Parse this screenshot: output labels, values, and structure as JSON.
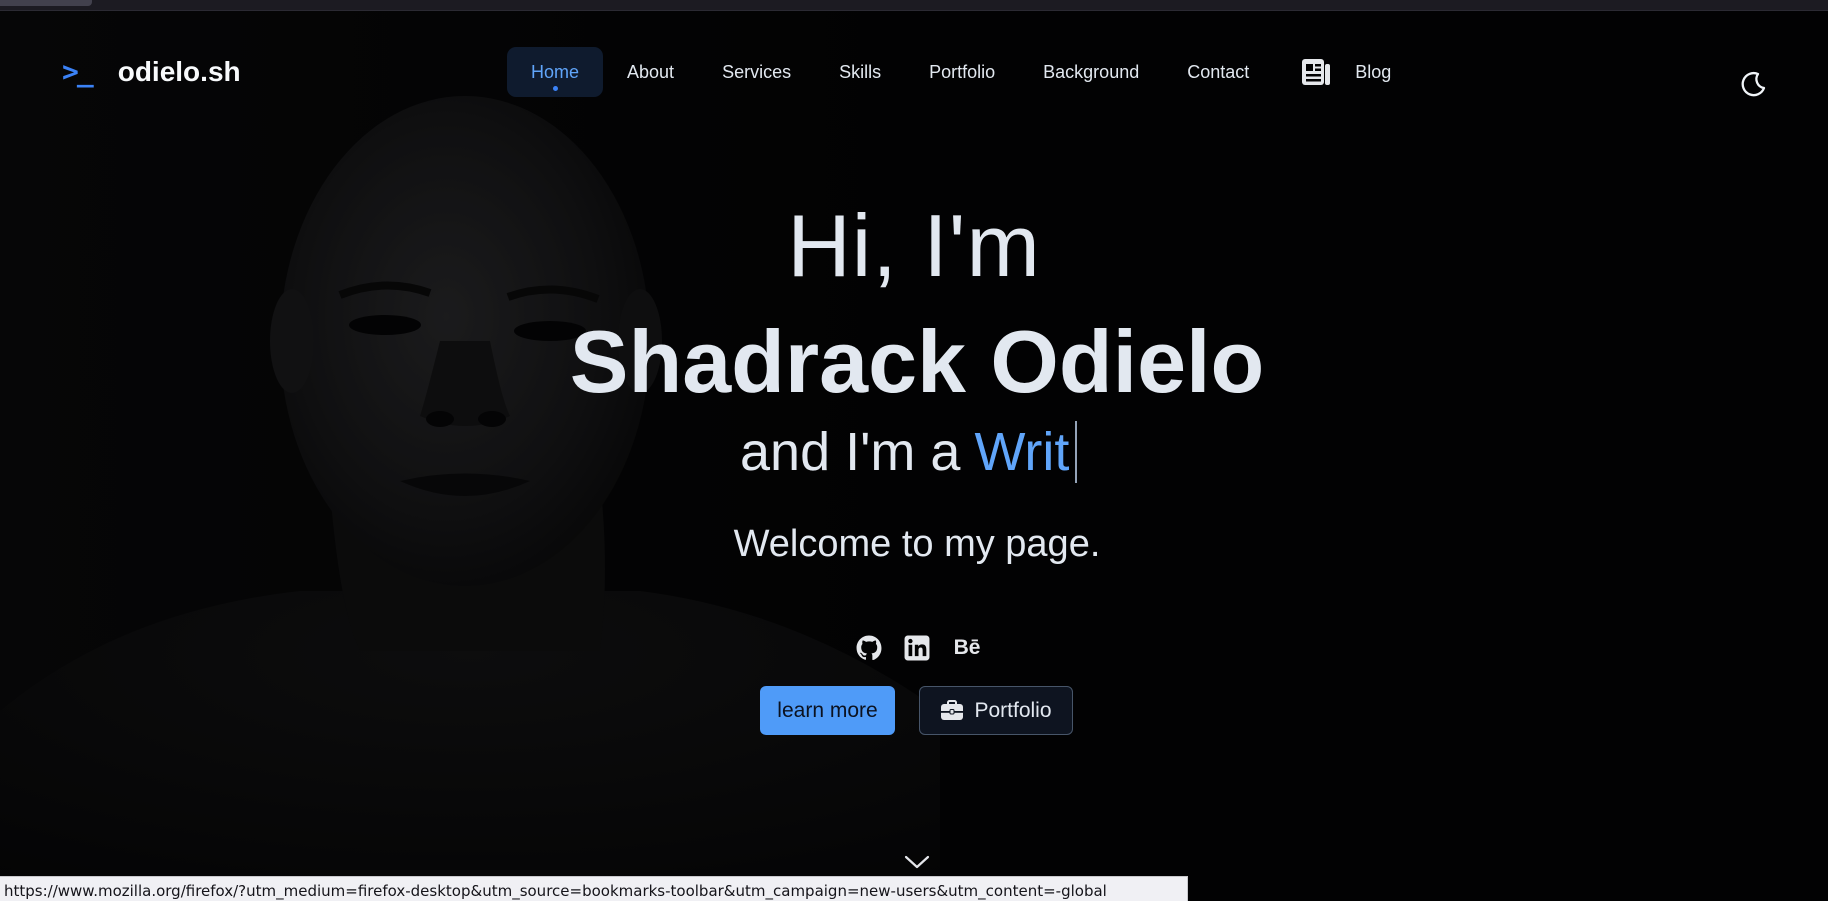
{
  "brand": {
    "prompt_glyph": ">_",
    "name": "odielo.sh"
  },
  "nav": {
    "items": [
      {
        "label": "Home",
        "active": true
      },
      {
        "label": "About"
      },
      {
        "label": "Services"
      },
      {
        "label": "Skills"
      },
      {
        "label": "Portfolio"
      },
      {
        "label": "Background"
      },
      {
        "label": "Contact"
      }
    ],
    "blog": {
      "label": "Blog",
      "icon": "newspaper-icon"
    },
    "theme_toggle_icon": "moon-icon"
  },
  "hero": {
    "greeting": "Hi, I'm",
    "name": "Shadrack Odielo",
    "role_prefix": "and I'm a",
    "role_typed": "Writ",
    "welcome": "Welcome to my page."
  },
  "socials": [
    {
      "icon": "github-icon"
    },
    {
      "icon": "linkedin-icon"
    },
    {
      "icon": "behance-icon",
      "label": "Bē"
    }
  ],
  "actions": {
    "learn_more": "learn more",
    "portfolio": "Portfolio",
    "portfolio_icon": "briefcase-icon"
  },
  "scroll_icon": "chevron-down-icon",
  "status_bar": {
    "url": "https://www.mozilla.org/firefox/?utm_medium=firefox-desktop&utm_source=bookmarks-toolbar&utm_campaign=new-users&utm_content=-global"
  },
  "colors": {
    "accent": "#3b82f6",
    "accent_light": "#60a5fa",
    "background": "#020203",
    "text": "#e2e8f0"
  }
}
